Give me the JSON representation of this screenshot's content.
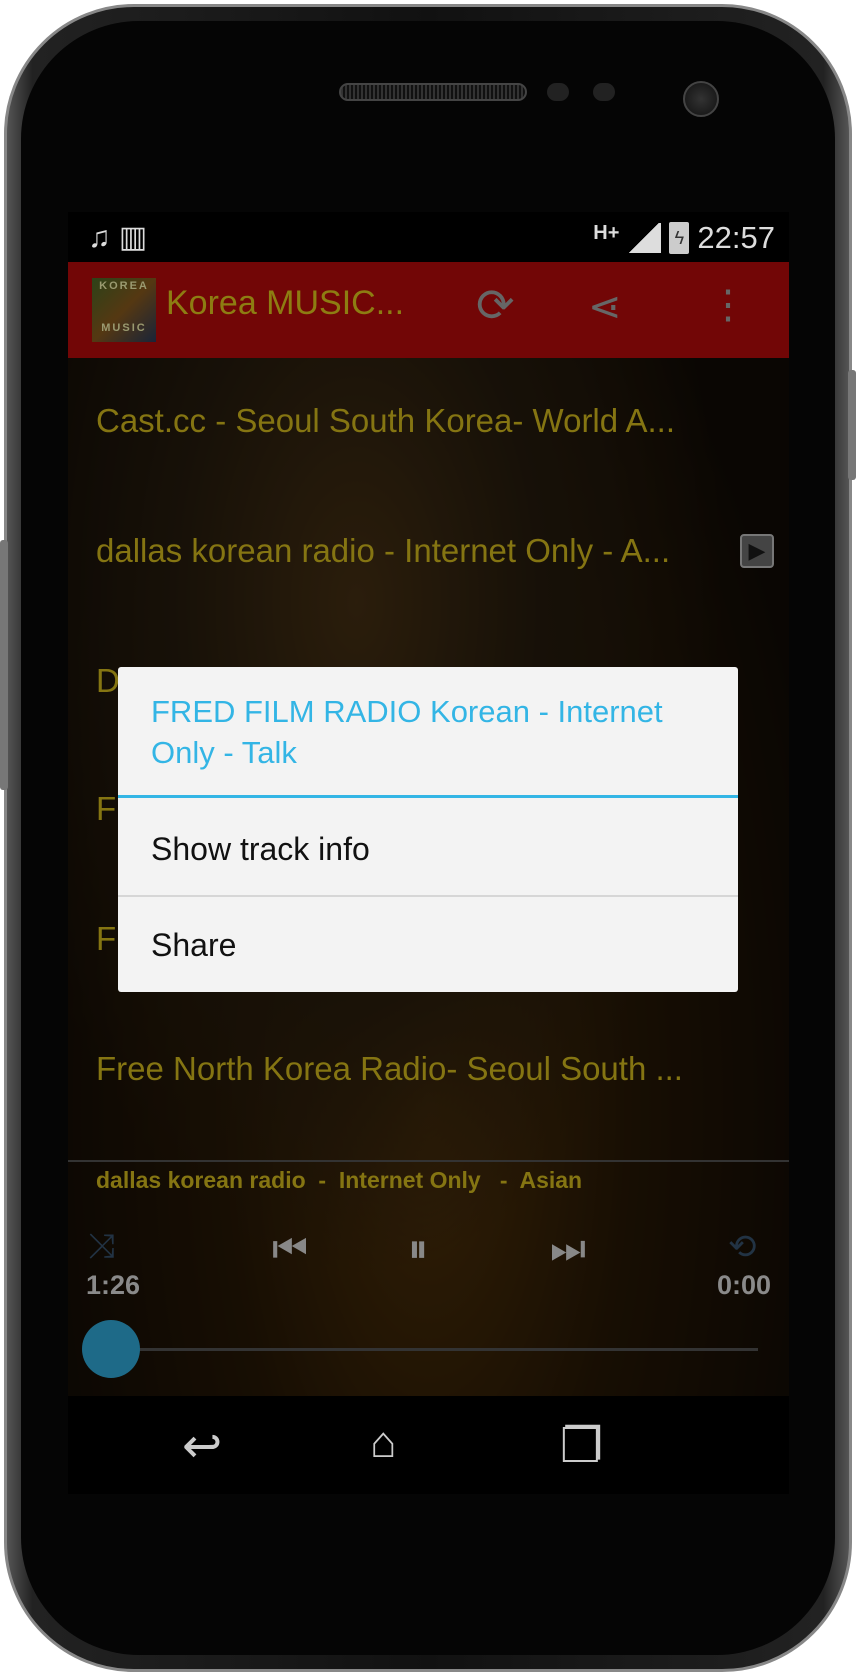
{
  "status_bar": {
    "left_icons": [
      "music-note-icon",
      "barcode-icon"
    ],
    "network": "H+",
    "time": "22:57"
  },
  "action_bar": {
    "logo_top": "KOREA",
    "logo_bottom": "MUSIC",
    "title": "Korea MUSIC...",
    "icons": [
      "refresh-icon",
      "share-icon",
      "overflow-menu-icon"
    ],
    "color": "#b50d0d"
  },
  "stations": [
    {
      "label": "Cast.cc  - Seoul South Korea- World A..."
    },
    {
      "label": "dallas korean radio - Internet Only  - A...",
      "playing": true
    },
    {
      "label": "D"
    },
    {
      "label": "F"
    },
    {
      "label": "F"
    },
    {
      "label": "Free North Korea Radio- Seoul South ..."
    }
  ],
  "player": {
    "now_playing": "dallas korean radio  -  Internet Only   -  Asian",
    "elapsed": "1:26",
    "duration": "0:00",
    "progress": 0
  },
  "dialog": {
    "title": "FRED FILM RADIO Korean  - Internet Only  - Talk",
    "items": [
      "Show track info",
      "Share"
    ],
    "accent": "#33b5e5"
  },
  "nav": [
    "back-icon",
    "home-icon",
    "recent-apps-icon"
  ]
}
